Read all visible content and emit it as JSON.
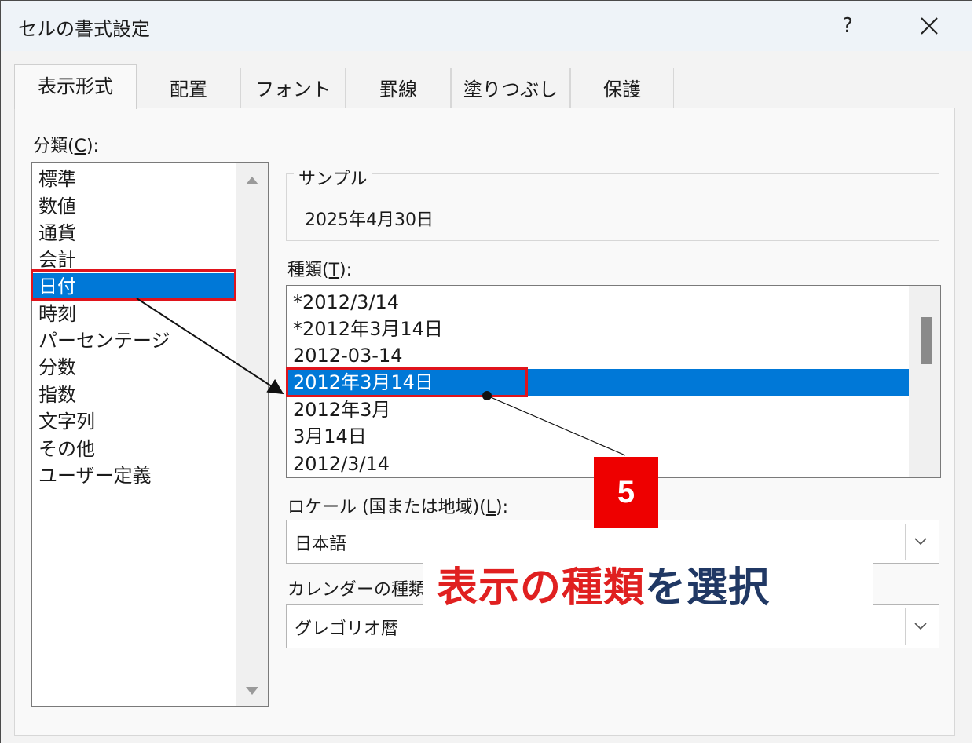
{
  "window": {
    "title": "セルの書式設定",
    "help_label": "?"
  },
  "tabs": [
    {
      "label": "表示形式",
      "active": true
    },
    {
      "label": "配置"
    },
    {
      "label": "フォント"
    },
    {
      "label": "罫線"
    },
    {
      "label": "塗りつぶし"
    },
    {
      "label": "保護"
    }
  ],
  "category": {
    "label_prefix": "分類(",
    "label_key": "C",
    "label_suffix": "):",
    "items": [
      "標準",
      "数値",
      "通貨",
      "会計",
      "日付",
      "時刻",
      "パーセンテージ",
      "分数",
      "指数",
      "文字列",
      "その他",
      "ユーザー定義"
    ],
    "selected": "日付"
  },
  "sample": {
    "legend": "サンプル",
    "value": "2025年4月30日"
  },
  "type": {
    "label_prefix": "種類(",
    "label_key": "T",
    "label_suffix": "):",
    "items": [
      "*2012/3/14",
      "*2012年3月14日",
      "2012-03-14",
      "2012年3月14日",
      "2012年3月",
      "3月14日",
      "2012/3/14"
    ],
    "selected": "2012年3月14日"
  },
  "locale": {
    "label_prefix": "ロケール (国または地域)(",
    "label_key": "L",
    "label_suffix": "):",
    "value": "日本語"
  },
  "calendar": {
    "label": "カレンダーの種類",
    "value": "グレゴリオ暦"
  },
  "annotation": {
    "step_number": "5",
    "text_red_1": "表示の種類",
    "text_navy": "を選択",
    "accent_red": "#e02020",
    "accent_navy": "#203864",
    "highlight_color": "#e0141c"
  },
  "colors": {
    "selection": "#0078d7"
  }
}
